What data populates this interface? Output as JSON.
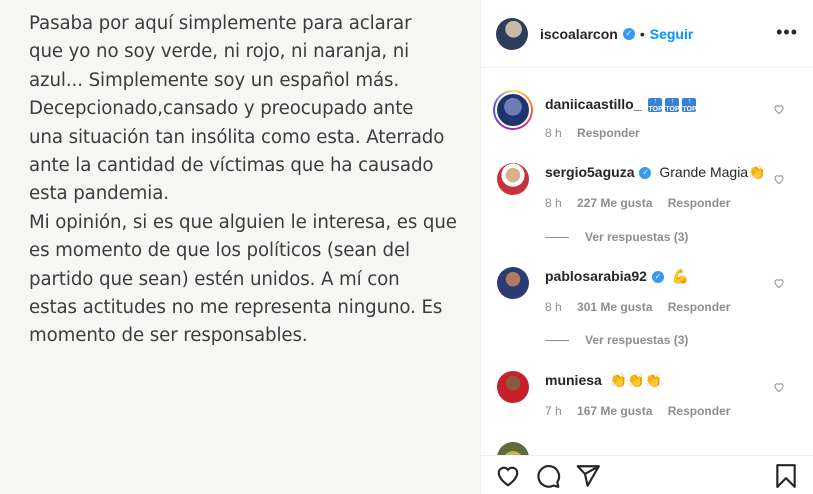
{
  "post": {
    "text": "Pasaba por aquí simplemente para aclarar\nque yo no soy verde, ni rojo, ni naranja, ni\nazul... Simplemente soy un español más.\nDecepcionado,cansado y preocupado ante\nuna situación tan insólita como esta. Aterrado\nante la cantidad de víctimas que ha causado\nesta pandemia.\nMi opinión, si es que alguien le interesa, es que\nes momento de que los políticos (sean del\npartido que sean) estén unidos. A mí con\nestas actitudes no me representa ninguno. Es\nmomento de ser responsables."
  },
  "header": {
    "username": "iscoalarcon",
    "separator": "•",
    "follow_label": "Seguir",
    "more_icon": "more-horizontal-icon"
  },
  "comments": [
    {
      "username": "daniicaastillo_",
      "text": "",
      "emoji": [
        "TOP",
        "TOP",
        "TOP"
      ],
      "time": "8 h",
      "likes": "",
      "reply_label": "Responder",
      "replies": ""
    },
    {
      "username": "sergio5aguza",
      "verified": true,
      "text": "Grande Magia👏",
      "time": "8 h",
      "likes": "227 Me gusta",
      "reply_label": "Responder",
      "replies": "Ver respuestas (3)"
    },
    {
      "username": "pablosarabia92",
      "verified": true,
      "text": "💪",
      "time": "8 h",
      "likes": "301 Me gusta",
      "reply_label": "Responder",
      "replies": "Ver respuestas (3)"
    },
    {
      "username": "muniesa",
      "text": "👏👏👏",
      "time": "7 h",
      "likes": "167 Me gusta",
      "reply_label": "Responder",
      "replies": ""
    }
  ],
  "colors": {
    "accent": "#0095f6",
    "verified": "#3897f0",
    "muted": "#8e8e8e"
  }
}
